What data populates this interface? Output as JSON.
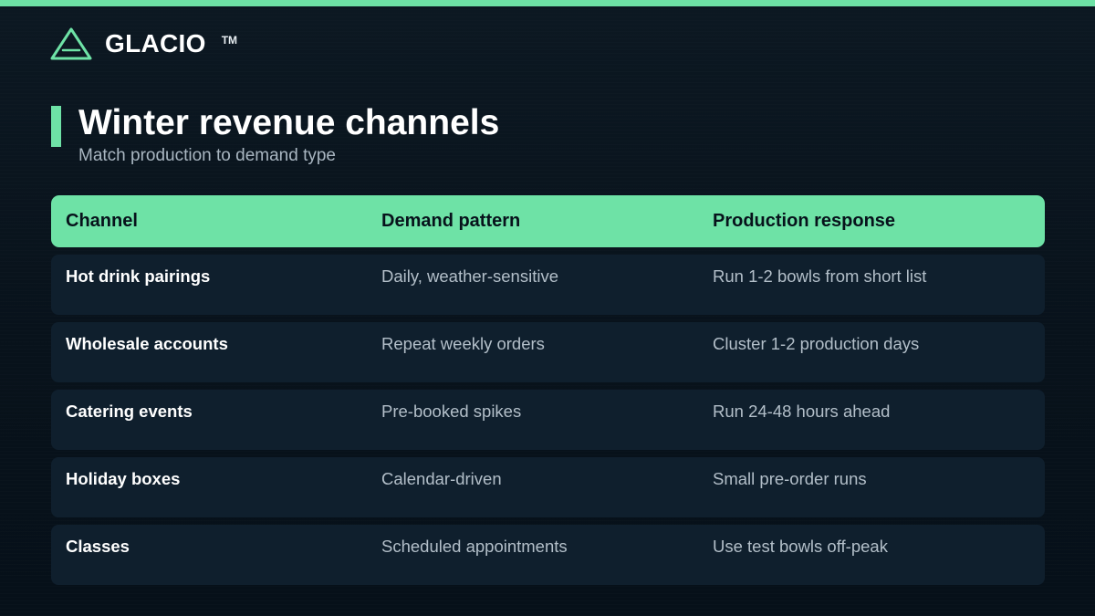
{
  "colors": {
    "accent": "#6ee2a6",
    "background": "#07111a",
    "row_background": "#0f1f2d",
    "header_text": "#07121b"
  },
  "brand": {
    "name": "GLACIO",
    "tm": "TM",
    "logo_icon": "triangle-logo-icon"
  },
  "slide": {
    "title": "Winter revenue channels",
    "subtitle": "Match production to demand type"
  },
  "table": {
    "headers": [
      "Channel",
      "Demand pattern",
      "Production response"
    ],
    "rows": [
      [
        "Hot drink pairings",
        "Daily, weather-sensitive",
        "Run 1-2 bowls from short list"
      ],
      [
        "Wholesale accounts",
        "Repeat weekly orders",
        "Cluster 1-2 production days"
      ],
      [
        "Catering events",
        "Pre-booked spikes",
        "Run 24-48 hours ahead"
      ],
      [
        "Holiday boxes",
        "Calendar-driven",
        "Small pre-order runs"
      ],
      [
        "Classes",
        "Scheduled appointments",
        "Use test bowls off-peak"
      ]
    ]
  }
}
